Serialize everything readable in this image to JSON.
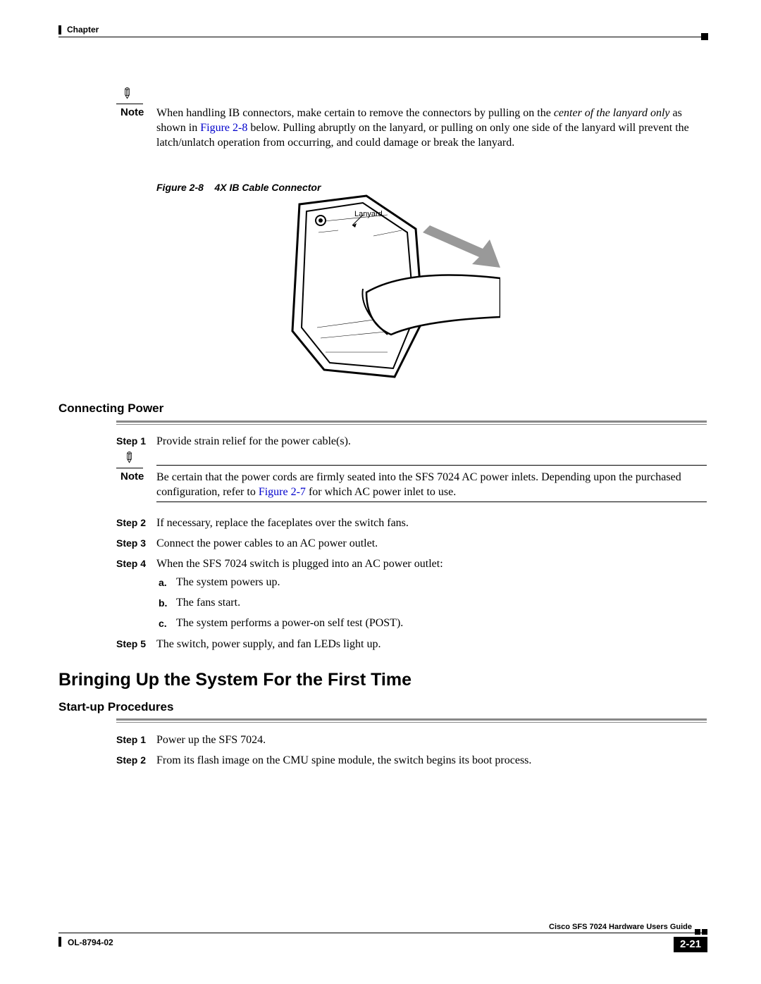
{
  "header": {
    "chapter": "Chapter"
  },
  "note1": {
    "label": "Note",
    "line1_a": "When handling IB connectors, make certain to remove the connectors by pulling on the ",
    "line1_b_ital": "center of the lanyard only",
    "line1_c": " as shown in ",
    "link": "Figure 2-8",
    "line1_d": " below. Pulling abruptly on the lanyard, or pulling on only one side of the lanyard will prevent the latch/unlatch operation from occurring, and could damage or break the lanyard."
  },
  "figure": {
    "caption_num": "Figure 2-8",
    "caption_title": "4X IB Cable Connector",
    "lanyard_label": "Lanyard"
  },
  "connecting_power": {
    "heading": "Connecting Power",
    "steps": {
      "s1": {
        "label": "Step 1",
        "text": "Provide strain relief for the power cable(s)."
      },
      "s2": {
        "label": "Step 2",
        "text": "If necessary, replace the faceplates over the switch fans."
      },
      "s3": {
        "label": "Step 3",
        "text": "Connect the power cables to an AC power outlet."
      },
      "s4": {
        "label": "Step 4",
        "text": "When the SFS 7024 switch is plugged into an AC power outlet:"
      },
      "s4a": {
        "label": "a.",
        "text": "The system powers up."
      },
      "s4b": {
        "label": "b.",
        "text": "The fans start."
      },
      "s4c": {
        "label": "c.",
        "text": "The system performs a power-on self test (POST)."
      },
      "s5": {
        "label": "Step 5",
        "text": "The switch, power supply, and fan LEDs light up."
      }
    },
    "note2": {
      "label": "Note",
      "text_a": "Be certain that the power cords are firmly seated into the SFS 7024 AC power inlets. Depending upon the purchased configuration, refer to ",
      "link": "Figure 2-7",
      "text_b": " for which AC power inlet to use."
    }
  },
  "bringing_up": {
    "heading": "Bringing Up the System For the First Time"
  },
  "startup": {
    "heading": "Start-up Procedures",
    "steps": {
      "s1": {
        "label": "Step 1",
        "text": "Power up the SFS 7024."
      },
      "s2": {
        "label": "Step 2",
        "text": "From its flash image on the CMU spine module, the switch begins its boot process."
      }
    }
  },
  "footer": {
    "doc_title": "Cisco SFS 7024 Hardware Users Guide",
    "page": "2-21",
    "doc_num": "OL-8794-02"
  }
}
